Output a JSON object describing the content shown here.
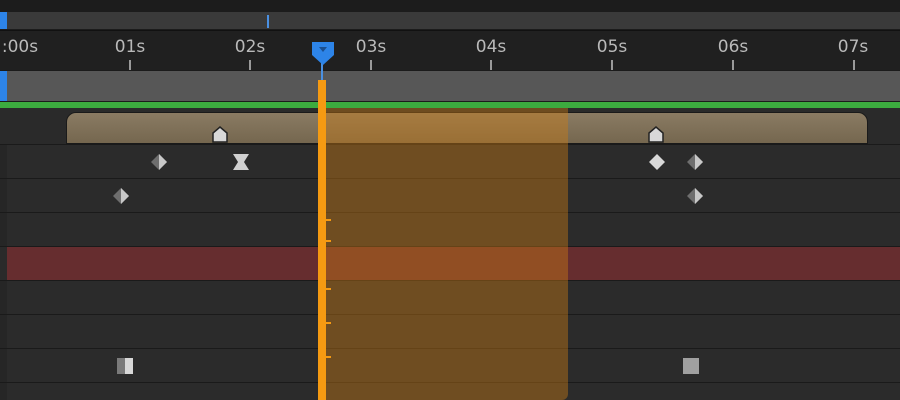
{
  "timeline": {
    "ruler": {
      "labels": [
        ":00s",
        "01s",
        "02s",
        "03s",
        "04s",
        "05s",
        "06s",
        "07s"
      ]
    },
    "current_time_indicator": {
      "time_seconds": 2.6
    },
    "work_area": {
      "in_seconds": 2.6,
      "out_seconds": 4.62
    },
    "colors": {
      "cti": "#f59a12",
      "work_area_overlay": "#cd7d14",
      "range_bar": "#3cab3f",
      "selected_track": "#662d2f",
      "handle_blue": "#2d84e8"
    }
  }
}
